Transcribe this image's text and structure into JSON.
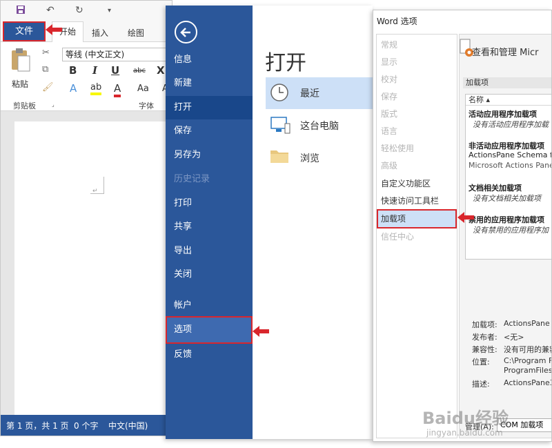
{
  "word": {
    "file_tab": "文件",
    "tabs": [
      "开始",
      "插入",
      "绘图"
    ],
    "font_name": "等线 (中文正文)",
    "paste_label": "粘贴",
    "clipboard_group": "剪贴板",
    "font_group": "字体",
    "format_buttons": [
      "B",
      "I",
      "U",
      "abc",
      "X"
    ],
    "status": {
      "page": "第 1 页，共 1 页",
      "words": "0 个字",
      "lang": "中文(中国)"
    }
  },
  "backstage": {
    "nav": [
      {
        "label": "信息",
        "state": "normal"
      },
      {
        "label": "新建",
        "state": "normal"
      },
      {
        "label": "打开",
        "state": "selected"
      },
      {
        "label": "保存",
        "state": "normal"
      },
      {
        "label": "另存为",
        "state": "normal"
      },
      {
        "label": "历史记录",
        "state": "disabled"
      },
      {
        "label": "打印",
        "state": "normal"
      },
      {
        "label": "共享",
        "state": "normal"
      },
      {
        "label": "导出",
        "state": "normal"
      },
      {
        "label": "关闭",
        "state": "normal"
      },
      {
        "label": "帐户",
        "state": "normal"
      },
      {
        "label": "选项",
        "state": "highlighted"
      },
      {
        "label": "反馈",
        "state": "normal"
      }
    ],
    "title": "打开",
    "locations": [
      "最近",
      "这台电脑",
      "浏览"
    ]
  },
  "options": {
    "window_title": "Word 选项",
    "categories": [
      "常规",
      "显示",
      "校对",
      "保存",
      "版式",
      "语言",
      "轻松使用",
      "高级",
      "自定义功能区",
      "快速访问工具栏",
      "加载项",
      "信任中心"
    ],
    "heading": "查看和管理 Micr",
    "section_bar": "加载项",
    "list_header": "名称 ▴",
    "groups": {
      "active": "活动应用程序加载项",
      "active_item": "没有活动应用程序加载",
      "inactive": "非活动应用程序加载项",
      "inactive_item1": "ActionsPane Schema fo",
      "inactive_item2": "Microsoft Actions Pane",
      "doc": "文档相关加载项",
      "doc_item": "没有文档相关加载项",
      "disabled": "禁用的应用程序加载项",
      "disabled_item": "没有禁用的应用程序加"
    },
    "details": {
      "addin_label": "加载项:",
      "addin_value": "ActionsPane S",
      "publisher_label": "发布者:",
      "publisher_value": "<无>",
      "compat_label": "兼容性:",
      "compat_value": "没有可用的兼容",
      "location_label": "位置:",
      "location_value1": "C:\\Program F",
      "location_value2": "ProgramFiles",
      "desc_label": "描述:",
      "desc_value": "ActionsPane3"
    },
    "manage_label": "管理(A):",
    "manage_value": "COM 加载项"
  },
  "watermark": {
    "logo": "Baidu经验",
    "sub": "jingyan.baidu.com"
  },
  "colors": {
    "word_blue": "#2b579a",
    "highlight_red": "#d9262c",
    "selected_blue": "#cde0f7"
  }
}
